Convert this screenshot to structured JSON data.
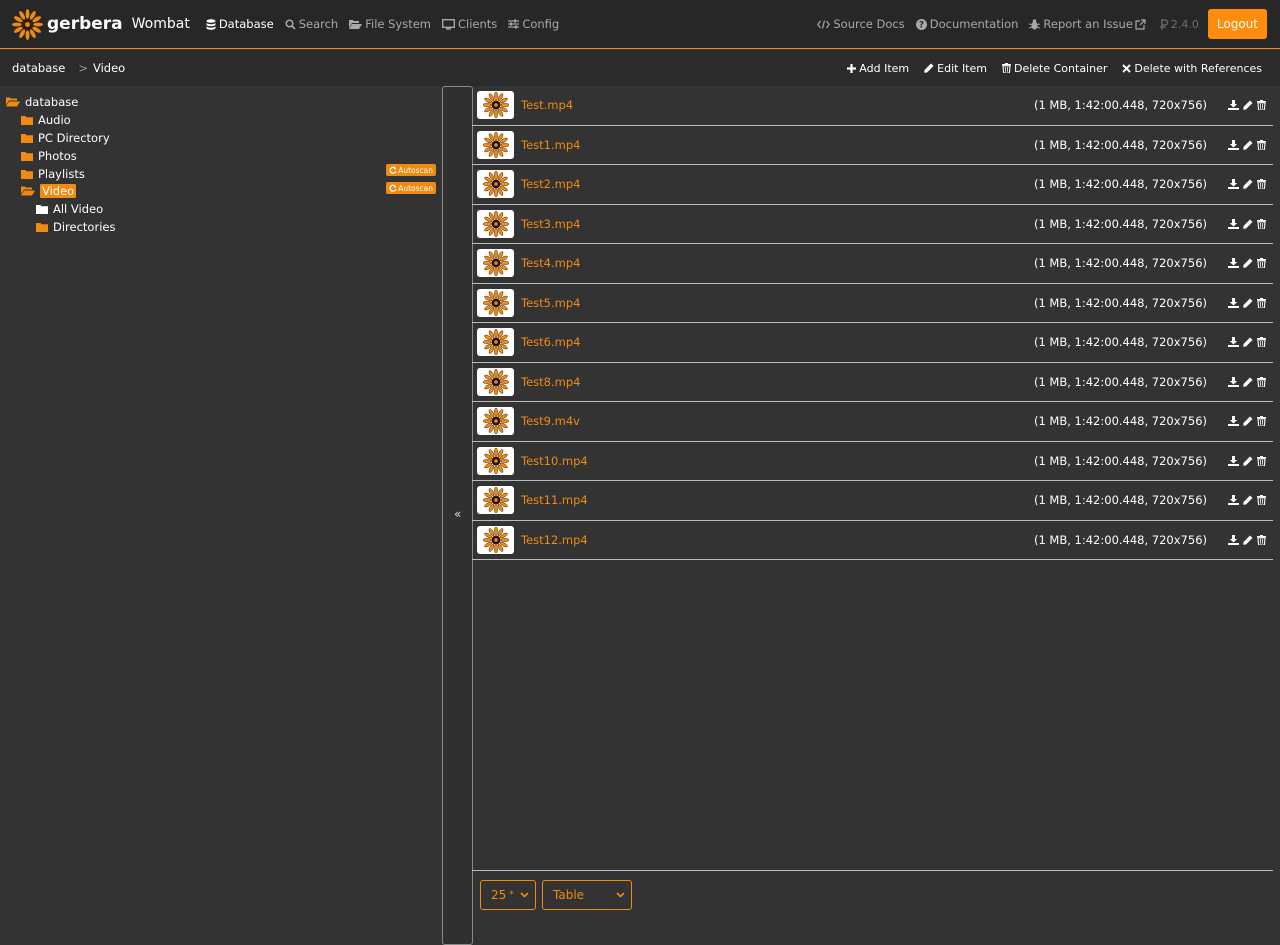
{
  "app": {
    "brand": "gerbera",
    "sub": "Wombat",
    "nav": [
      {
        "label": "Database",
        "icon": "database-icon",
        "active": true
      },
      {
        "label": "Search",
        "icon": "search-icon",
        "active": false
      },
      {
        "label": "File System",
        "icon": "folder-open-icon",
        "active": false
      },
      {
        "label": "Clients",
        "icon": "monitor-icon",
        "active": false
      },
      {
        "label": "Config",
        "icon": "sliders-icon",
        "active": false
      }
    ],
    "right": {
      "source_docs": "Source Docs",
      "documentation": "Documentation",
      "report": "Report an Issue",
      "version": "2.4.0",
      "logout": "Logout"
    }
  },
  "breadcrumb": [
    "database",
    "Video"
  ],
  "actions": [
    {
      "label": "Add Item",
      "icon": "plus-icon"
    },
    {
      "label": "Edit Item",
      "icon": "pencil-icon"
    },
    {
      "label": "Delete Container",
      "icon": "trash-icon"
    },
    {
      "label": "Delete with References",
      "icon": "x-icon"
    }
  ],
  "tree": {
    "root": "database",
    "children": [
      {
        "label": "Audio"
      },
      {
        "label": "PC Directory"
      },
      {
        "label": "Photos"
      },
      {
        "label": "Playlists",
        "badge": "Autoscan"
      },
      {
        "label": "Video",
        "badge": "Autoscan",
        "selected": true,
        "children": [
          {
            "label": "All Video"
          },
          {
            "label": "Directories"
          }
        ]
      }
    ]
  },
  "items": [
    {
      "title": "Test.mp4",
      "meta": "(1 MB, 1:42:00.448, 720x756)"
    },
    {
      "title": "Test1.mp4",
      "meta": "(1 MB, 1:42:00.448, 720x756)"
    },
    {
      "title": "Test2.mp4",
      "meta": "(1 MB, 1:42:00.448, 720x756)"
    },
    {
      "title": "Test3.mp4",
      "meta": "(1 MB, 1:42:00.448, 720x756)"
    },
    {
      "title": "Test4.mp4",
      "meta": "(1 MB, 1:42:00.448, 720x756)"
    },
    {
      "title": "Test5.mp4",
      "meta": "(1 MB, 1:42:00.448, 720x756)"
    },
    {
      "title": "Test6.mp4",
      "meta": "(1 MB, 1:42:00.448, 720x756)"
    },
    {
      "title": "Test8.mp4",
      "meta": "(1 MB, 1:42:00.448, 720x756)"
    },
    {
      "title": "Test9.m4v",
      "meta": "(1 MB, 1:42:00.448, 720x756)"
    },
    {
      "title": "Test10.mp4",
      "meta": "(1 MB, 1:42:00.448, 720x756)"
    },
    {
      "title": "Test11.mp4",
      "meta": "(1 MB, 1:42:00.448, 720x756)"
    },
    {
      "title": "Test12.mp4",
      "meta": "(1 MB, 1:42:00.448, 720x756)"
    }
  ],
  "pager": {
    "page_size": "25",
    "view": "Table"
  },
  "colors": {
    "accent": "#f08a12",
    "bg": "#333333",
    "topbar": "#272727"
  }
}
